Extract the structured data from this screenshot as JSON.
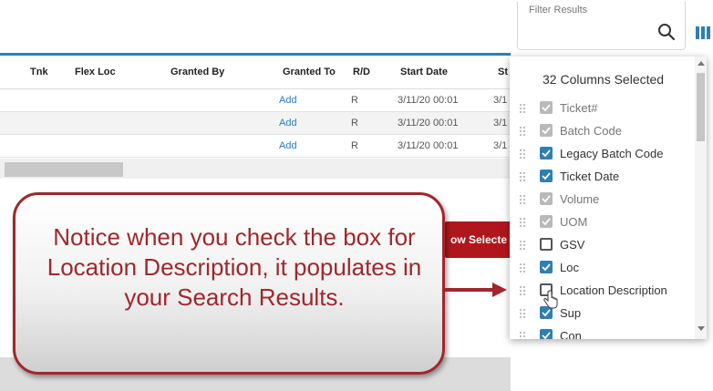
{
  "filter": {
    "label": "Filter Results",
    "value": "",
    "placeholder": ""
  },
  "table": {
    "headers": [
      "Tnk",
      "Flex Loc",
      "Granted By",
      "Granted To",
      "R/D",
      "Start Date",
      "St"
    ],
    "rows": [
      {
        "granted_to": "Add",
        "rd": "R",
        "start_date": "3/11/20 00:01",
        "st": "3/1"
      },
      {
        "granted_to": "Add",
        "rd": "R",
        "start_date": "3/11/20 00:01",
        "st": "3/1"
      },
      {
        "granted_to": "Add",
        "rd": "R",
        "start_date": "3/11/20 00:01",
        "st": "3/1"
      }
    ]
  },
  "red_button": {
    "label": "ow Selecte"
  },
  "columns_panel": {
    "title": "32 Columns Selected",
    "items": [
      {
        "label": "Ticket#",
        "state": "checked-disabled"
      },
      {
        "label": "Batch Code",
        "state": "checked-disabled"
      },
      {
        "label": "Legacy Batch Code",
        "state": "checked"
      },
      {
        "label": "Ticket Date",
        "state": "checked"
      },
      {
        "label": "Volume",
        "state": "checked-disabled"
      },
      {
        "label": "UOM",
        "state": "checked-disabled"
      },
      {
        "label": "GSV",
        "state": "unchecked"
      },
      {
        "label": "Loc",
        "state": "checked"
      },
      {
        "label": "Location Description",
        "state": "unchecked"
      },
      {
        "label": "Sup",
        "state": "checked"
      },
      {
        "label": "Con",
        "state": "checked"
      }
    ]
  },
  "callout": {
    "text": "Notice when you check the box for Location Description, it populates in your Search Results."
  },
  "colors": {
    "accent": "#2f7fb0",
    "callout_red": "#a0272c",
    "button_red": "#b0171d",
    "link": "#2a7bc4"
  }
}
